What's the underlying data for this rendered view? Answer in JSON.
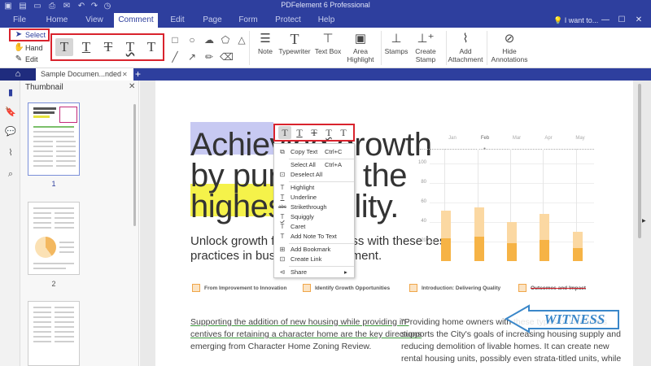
{
  "app": {
    "title": "PDFelement 6 Professional"
  },
  "menu": {
    "items": [
      "File",
      "Home",
      "View",
      "Comment",
      "Edit",
      "Page",
      "Form",
      "Protect",
      "Help"
    ],
    "active": "Comment",
    "search": "I want to..."
  },
  "window_controls": {
    "minimize": "—",
    "maximize": "☐",
    "close": "✕"
  },
  "ribbon": {
    "modes": {
      "select": "Select",
      "hand": "Hand",
      "edit": "Edit"
    },
    "text_tools": [
      "T",
      "T",
      "T",
      "T",
      "T"
    ],
    "buttons": {
      "note": "Note",
      "typewriter": "Typewriter",
      "textbox": "Text Box",
      "area_highlight_1": "Area",
      "area_highlight_2": "Highlight",
      "stamps": "Stamps",
      "create_stamp_1": "Create",
      "create_stamp_2": "Stamp",
      "add_attachment_1": "Add",
      "add_attachment_2": "Attachment",
      "hide_annotations_1": "Hide",
      "hide_annotations_2": "Annotations"
    }
  },
  "tabs": {
    "doc_label": "Sample Documen...nded",
    "close": "✕",
    "add": "+"
  },
  "thumbnails": {
    "title": "Thumbnail",
    "close": "✕",
    "pages": [
      "1",
      "2"
    ]
  },
  "document": {
    "headline": [
      "Achieving growth",
      "by pursuing the",
      "highest quality."
    ],
    "subtitle": [
      "Unlock growth for your business with these best",
      "practices in business management."
    ],
    "chart": {
      "months": [
        "Jan",
        "Feb",
        "Mar",
        "Apr",
        "May"
      ],
      "yticks": [
        "100",
        "80",
        "60",
        "40",
        "20"
      ]
    },
    "tags": [
      "From Improvement to Innovation",
      "Identify Growth Opportunities",
      "Introduction: Delivering Quality",
      "Outcomes and Impact"
    ],
    "para_left": [
      "Supporting the addition of new housing while providing in-",
      "centives for retaining a character home are the key directions",
      "emerging from Character Home Zoning Review."
    ],
    "para_right": [
      "\"Providing home owners with these types of incentives",
      "supports the City's goals of increasing housing supply and",
      "reducing demolition of livable homes.  It can create new",
      "rental housing units, possibly even strata-titled units, while"
    ],
    "stamp": "WITNESS"
  },
  "chart_data": {
    "type": "bar",
    "categories": [
      "Jan",
      "Feb",
      "Mar",
      "Apr",
      "May"
    ],
    "series": [
      {
        "values": [
          52,
          55,
          40,
          48,
          30
        ]
      }
    ],
    "ylim": [
      0,
      100
    ]
  },
  "context_menu": {
    "toolbar": [
      "T",
      "T",
      "T",
      "T",
      "T"
    ],
    "items": [
      {
        "label": "Copy Text",
        "shortcut": "Ctrl+C",
        "icon": "⧉"
      },
      {
        "label": "Select All",
        "shortcut": "Ctrl+A",
        "icon": ""
      },
      {
        "label": "Deselect All",
        "shortcut": "",
        "icon": "⊡"
      },
      {
        "label": "Highlight",
        "shortcut": "",
        "icon": "T"
      },
      {
        "label": "Underline",
        "shortcut": "",
        "icon": "T"
      },
      {
        "label": "Strikethrough",
        "shortcut": "",
        "icon": "abc"
      },
      {
        "label": "Squiggly",
        "shortcut": "",
        "icon": "T"
      },
      {
        "label": "Caret",
        "shortcut": "",
        "icon": "T"
      },
      {
        "label": "Add Note To Text",
        "shortcut": "",
        "icon": "T"
      },
      {
        "label": "Add Bookmark",
        "shortcut": "",
        "icon": "⊞"
      },
      {
        "label": "Create Link",
        "shortcut": "",
        "icon": "⊡"
      },
      {
        "label": "Share",
        "shortcut": "",
        "icon": "⊲"
      }
    ],
    "share_arrow": "▸"
  },
  "colors": {
    "brand": "#2e3f9e",
    "red_box": "#d9232d",
    "highlight_blue": "#c7c9f2",
    "highlight_yellow": "#f5f24a",
    "bar_light": "#fbd8a2",
    "bar_dark": "#f6b345",
    "stamp_blue": "#3a87c9"
  }
}
